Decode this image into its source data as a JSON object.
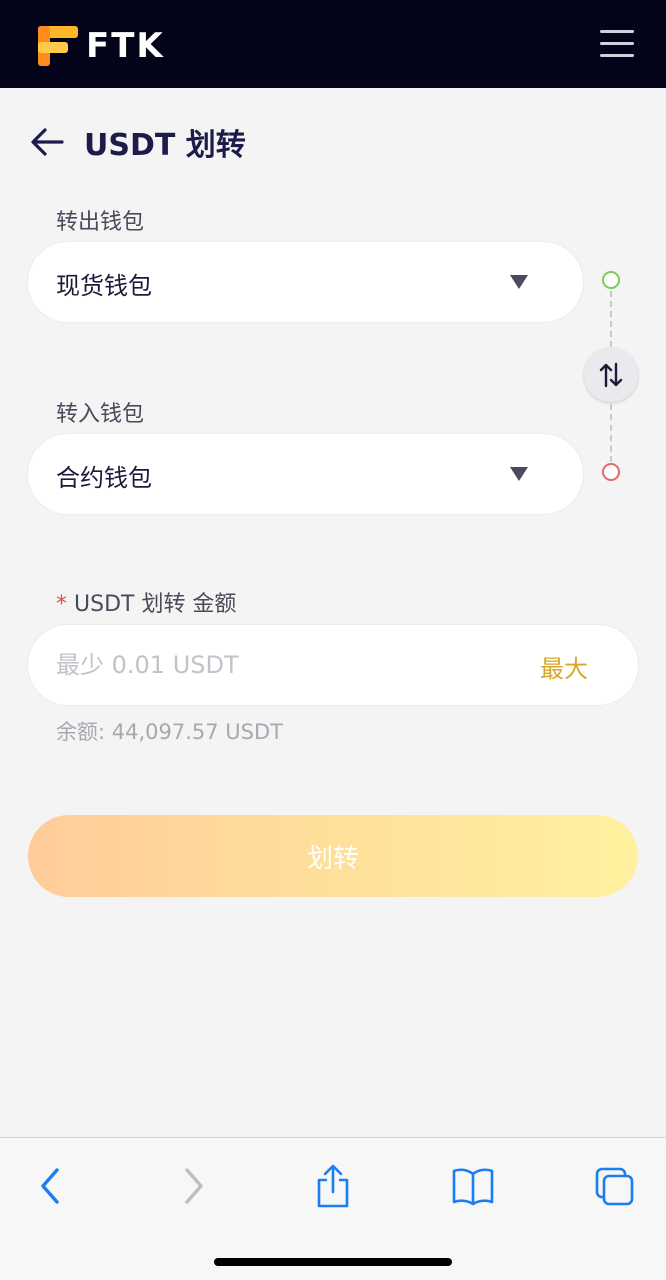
{
  "brand": {
    "name": "FTK"
  },
  "header": {
    "title": "USDT 划转"
  },
  "from_wallet": {
    "label": "转出钱包",
    "value": "现货钱包"
  },
  "to_wallet": {
    "label": "转入钱包",
    "value": "合约钱包"
  },
  "amount": {
    "required_mark": "*",
    "label": "USDT 划转 金额",
    "placeholder": "最少 0.01 USDT",
    "value": "",
    "max_label": "最大"
  },
  "balance": {
    "text": "余额: 44,097.57 USDT"
  },
  "submit": {
    "label": "划转"
  },
  "browser_bar": {
    "icons": [
      "back-icon",
      "forward-icon",
      "share-icon",
      "bookmarks-icon",
      "tabs-icon"
    ]
  },
  "colors": {
    "topbar": "#03031a",
    "accent": "#d9a62e",
    "from_dot": "#7dc95a",
    "to_dot": "#e36b6b",
    "ios_blue": "#1a7ef2"
  }
}
